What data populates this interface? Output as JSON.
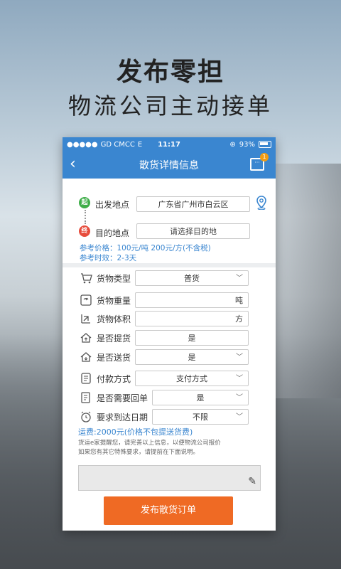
{
  "promo": {
    "title": "发布零担",
    "subtitle": "物流公司主动接单"
  },
  "status_bar": {
    "carrier": "GD CMCC",
    "network": "E",
    "time": "11:17",
    "battery": "93%"
  },
  "nav": {
    "title": "散货详情信息",
    "badge_count": "1"
  },
  "route": {
    "start_pin": "起",
    "end_pin": "终",
    "origin_label": "出发地点",
    "origin_value": "广东省广州市白云区",
    "destination_label": "目的地点",
    "destination_placeholder": "请选择目的地",
    "ref_price": "参考价格：100元/吨  200元/方(不含税)",
    "ref_time": "参考时效：2-3天"
  },
  "form": {
    "cargo_type": {
      "label": "货物类型",
      "value": "普货"
    },
    "cargo_weight": {
      "label": "货物重量",
      "unit": "吨"
    },
    "cargo_volume": {
      "label": "货物体积",
      "unit": "方"
    },
    "pickup": {
      "label": "是否提货",
      "value": "是"
    },
    "delivery": {
      "label": "是否送货",
      "value": "是"
    },
    "payment": {
      "label": "付款方式",
      "value": "支付方式"
    },
    "receipt": {
      "label": "是否需要回单",
      "value": "是"
    },
    "deadline": {
      "label": "要求到达日期",
      "value": "不限"
    }
  },
  "freight": "运费:2000元(价格不包提送货费)",
  "notice_line1": "货运e家提醒您，请完善以上信息，以便物流公司报价",
  "notice_line2": "如果您有其它特殊要求，请提前在下面说明。",
  "submit_label": "发布散货订单",
  "colors": {
    "primary": "#3a86d0",
    "accent": "#ef6a24",
    "start": "#3fae49",
    "end": "#e74c3c"
  }
}
